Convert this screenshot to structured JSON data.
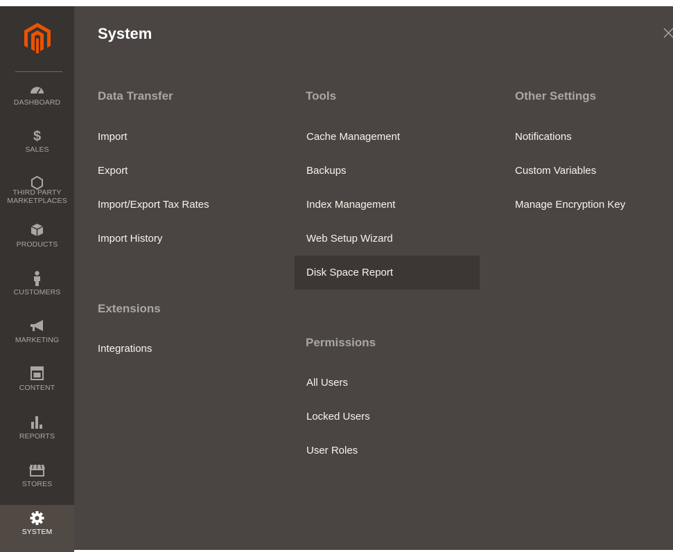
{
  "sidebar": {
    "items": [
      {
        "key": "dashboard",
        "label": "DASHBOARD"
      },
      {
        "key": "sales",
        "label": "SALES"
      },
      {
        "key": "third-party",
        "label_l1": "THIRD PARTY",
        "label_l2": "MARKETPLACES"
      },
      {
        "key": "products",
        "label": "PRODUCTS"
      },
      {
        "key": "customers",
        "label": "CUSTOMERS"
      },
      {
        "key": "marketing",
        "label": "MARKETING"
      },
      {
        "key": "content",
        "label": "CONTENT"
      },
      {
        "key": "reports",
        "label": "REPORTS"
      },
      {
        "key": "stores",
        "label": "STORES"
      },
      {
        "key": "system",
        "label": "SYSTEM"
      }
    ],
    "active": "system"
  },
  "panel": {
    "title": "System",
    "columns": [
      {
        "groups": [
          {
            "heading": "Data Transfer",
            "links": [
              "Import",
              "Export",
              "Import/Export Tax Rates",
              "Import History"
            ]
          },
          {
            "heading": "Extensions",
            "links": [
              "Integrations"
            ]
          }
        ]
      },
      {
        "groups": [
          {
            "heading": "Tools",
            "links": [
              "Cache Management",
              "Backups",
              "Index Management",
              "Web Setup Wizard",
              "Disk Space Report"
            ]
          },
          {
            "heading": "Permissions",
            "links": [
              "All Users",
              "Locked Users",
              "User Roles"
            ]
          }
        ]
      },
      {
        "groups": [
          {
            "heading": "Other Settings",
            "links": [
              "Notifications",
              "Custom Variables",
              "Manage Encryption Key"
            ]
          }
        ]
      }
    ],
    "highlighted_link": "Disk Space Report"
  },
  "colors": {
    "sidebar_bg": "#373330",
    "panel_bg": "#4a4542",
    "active_item_bg": "#514943",
    "logo_orange": "#eb5202",
    "heading_gray": "#aaa6a0",
    "link_white": "#f7f3eb"
  }
}
